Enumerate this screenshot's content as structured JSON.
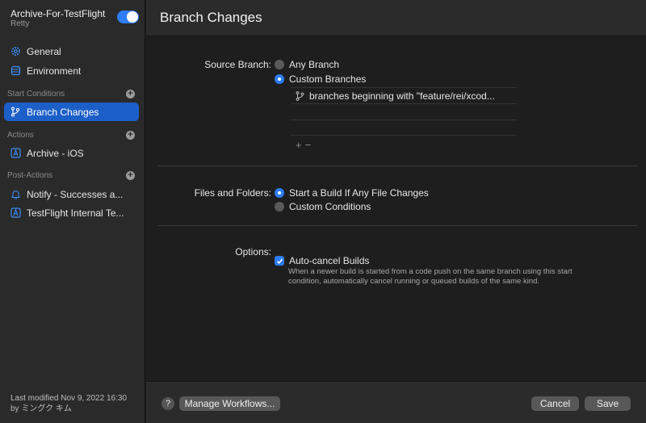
{
  "sidebar": {
    "workflow_title": "Archive-For-TestFlight",
    "workflow_subtitle": "Retty",
    "enabled": true,
    "general_label": "General",
    "environment_label": "Environment",
    "start_conditions_header": "Start Conditions",
    "start_conditions": [
      {
        "label": "Branch Changes",
        "icon": "branch-icon",
        "selected": true
      }
    ],
    "actions_header": "Actions",
    "actions": [
      {
        "label": "Archive - iOS",
        "icon": "xcode-app-icon"
      }
    ],
    "post_actions_header": "Post-Actions",
    "post_actions": [
      {
        "label": "Notify - Successes a...",
        "icon": "bell-icon"
      },
      {
        "label": "TestFlight Internal Te...",
        "icon": "xcode-app-icon"
      }
    ],
    "last_modified_line1": "Last modified Nov 9, 2022 16:30",
    "last_modified_line2": "by ミングク キム"
  },
  "main": {
    "title": "Branch Changes",
    "source_branch_label": "Source Branch:",
    "source_branch_options": [
      {
        "label": "Any Branch",
        "selected": false
      },
      {
        "label": "Custom Branches",
        "selected": true
      }
    ],
    "branch_rules": [
      "branches beginning with \"feature/rei/xcod..."
    ],
    "add_symbol": "+",
    "remove_symbol": "−",
    "files_label": "Files and Folders:",
    "files_options": [
      {
        "label": "Start a Build If Any File Changes",
        "selected": true
      },
      {
        "label": "Custom Conditions",
        "selected": false
      }
    ],
    "options_label": "Options:",
    "auto_cancel_label": "Auto-cancel Builds",
    "auto_cancel_checked": true,
    "auto_cancel_description": "When a newer build is started from a code push on the same branch using this start condition, automatically cancel running or queued builds of the same kind."
  },
  "footer": {
    "help": "?",
    "manage_workflows": "Manage Workflows...",
    "cancel": "Cancel",
    "save": "Save"
  },
  "colors": {
    "accent": "#2e7cf6",
    "selection": "#1c5fc8"
  }
}
